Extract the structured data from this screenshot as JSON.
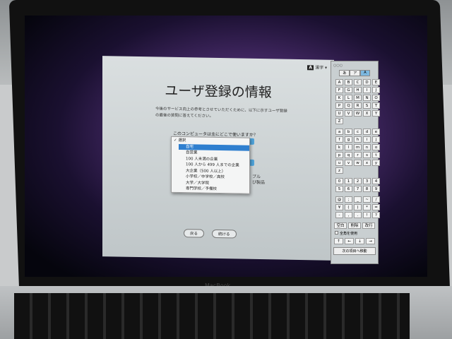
{
  "dialog": {
    "title": "ユーザ登録の情報",
    "description": "今後のサービス向上の参考とさせていただくために、以下に示すユーザ登録の最後の質問に答えてください。",
    "input_source": "漢字 ▾",
    "input_icon": "A",
    "question": "このコンピュータは主にどこで使いますか？",
    "menu": {
      "selected_check": "✓ 選択",
      "options": [
        "自宅",
        "自営業",
        "100 人未満の企業",
        "100 人から 499 人までの企業",
        "大企業（500 人以上）",
        "小学校／中学校／高校",
        "大学／大学院",
        "専門学校／予備校"
      ],
      "highlighted": "自宅"
    },
    "partial_text_1": "ブル",
    "partial_text_2": "び製品",
    "back_label": "戻る",
    "continue_label": "続ける"
  },
  "keyboard_viewer": {
    "window_controls": "○○○",
    "tabs": [
      "あ",
      "ア",
      "A"
    ],
    "active_tab": "A",
    "upper": [
      "A",
      "B",
      "C",
      "D",
      "E",
      "F",
      "G",
      "H",
      "I",
      "J",
      "K",
      "L",
      "M",
      "N",
      "O",
      "P",
      "Q",
      "R",
      "S",
      "T",
      "U",
      "V",
      "W",
      "X",
      "Y",
      "Z"
    ],
    "lower": [
      "a",
      "b",
      "c",
      "d",
      "e",
      "f",
      "g",
      "h",
      "i",
      "j",
      "k",
      "l",
      "m",
      "n",
      "o",
      "p",
      "q",
      "r",
      "s",
      "t",
      "u",
      "v",
      "w",
      "x",
      "y",
      "z"
    ],
    "digits": [
      "0",
      "1",
      "2",
      "3",
      "4",
      "5",
      "6",
      "7",
      "8",
      "9"
    ],
    "symbols": [
      "@",
      ";",
      "_",
      "~",
      "/",
      "¥",
      "(",
      ")",
      "*",
      "=",
      "-",
      ",",
      ".",
      "!",
      "?"
    ],
    "space_label": "空白",
    "delete_label": "削除",
    "return_label": "改行",
    "fullwidth_label": "全角を使用",
    "arrows": [
      "↑",
      "←",
      "↓",
      "→"
    ],
    "next_field_label": "次の項目へ移動"
  },
  "laptop_brand": "MacBook"
}
